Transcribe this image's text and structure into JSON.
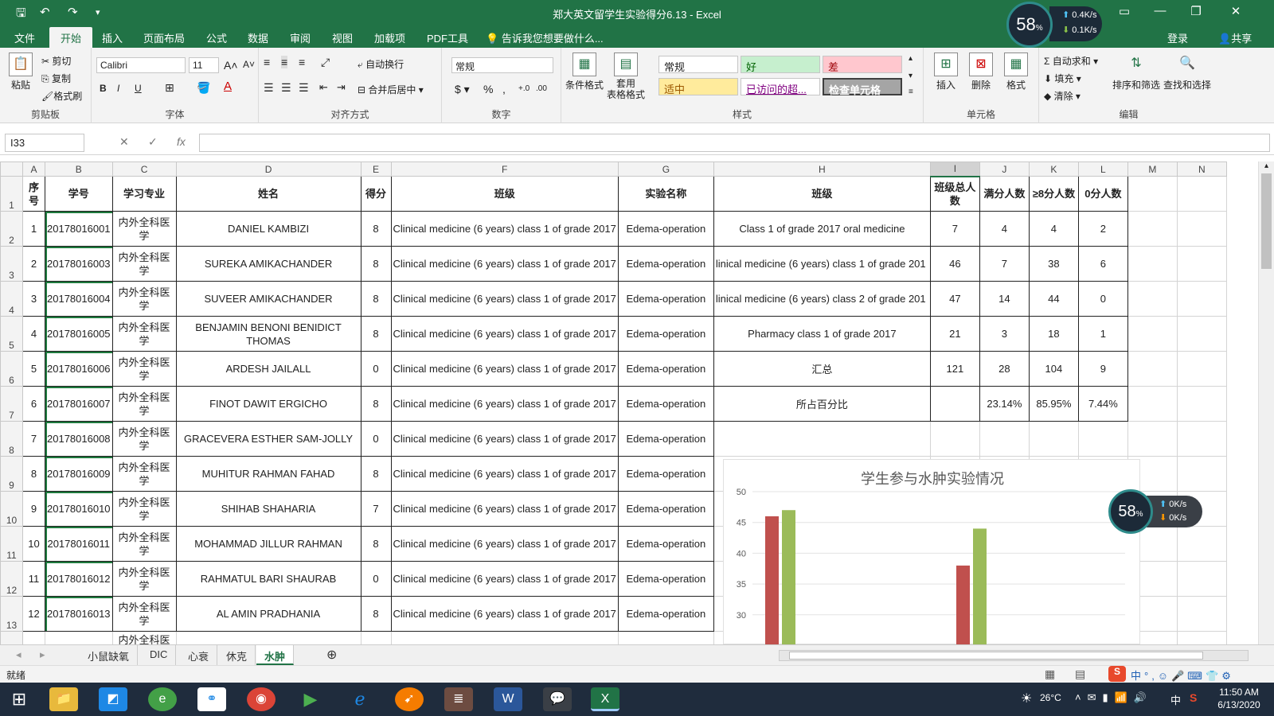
{
  "window": {
    "title": "郑大英文留学生实验得分6.13 - Excel"
  },
  "menus": [
    "文件",
    "开始",
    "插入",
    "页面布局",
    "公式",
    "数据",
    "审阅",
    "视图",
    "加载项",
    "PDF工具"
  ],
  "active_menu": "开始",
  "tell_me": "告诉我您想要做什么...",
  "account": {
    "login": "登录",
    "share": "共享"
  },
  "net_widget": {
    "percent": "58",
    "unit": "%",
    "up": "0.4K/s",
    "down": "0.1K/s"
  },
  "net_widget2": {
    "percent": "58",
    "unit": "%",
    "up": "0K/s",
    "down": "0K/s"
  },
  "ribbon": {
    "clipboard": {
      "paste": "粘贴",
      "cut": "剪切",
      "copy": "复制",
      "format_painter": "格式刷",
      "label": "剪贴板"
    },
    "font": {
      "name": "Calibri",
      "size": "11",
      "label": "字体",
      "bold": "B",
      "italic": "I",
      "underline": "U"
    },
    "align": {
      "wrap": "自动换行",
      "merge": "合并后居中",
      "label": "对齐方式"
    },
    "number": {
      "format": "常规",
      "label": "数字"
    },
    "styles": {
      "cond": "条件格式",
      "table": "套用\n表格格式",
      "normal": "常规",
      "good": "好",
      "bad": "差",
      "neutral": "适中",
      "visited": "已访问的超...",
      "check": "检查单元格",
      "label": "样式"
    },
    "cells": {
      "insert": "插入",
      "delete": "删除",
      "format": "格式",
      "label": "单元格"
    },
    "editing": {
      "autosum": "自动求和",
      "fill": "填充",
      "clear": "清除",
      "sort": "排序和筛选",
      "find": "查找和选择",
      "label": "编辑"
    }
  },
  "namebox": "I33",
  "columns": [
    "A",
    "B",
    "C",
    "D",
    "E",
    "F",
    "G",
    "H",
    "I",
    "J",
    "K",
    "L",
    "M",
    "N"
  ],
  "header_row": [
    "序号",
    "学号",
    "学习专业",
    "姓名",
    "得分",
    "班级",
    "实验名称",
    "班级",
    "班级总人数",
    "满分人数",
    "≥8分人数",
    "0分人数"
  ],
  "rows": [
    {
      "n": "1",
      "id": "20178016001",
      "major": "内外全科医学",
      "name": "DANIEL KAMBIZI",
      "score": "8",
      "class": "Clinical medicine (6 years) class 1 of grade 2017",
      "exp": "Edema-operation",
      "h": "Class 1 of grade 2017 oral medicine",
      "i": "7",
      "j": "4",
      "k": "4",
      "l": "2"
    },
    {
      "n": "2",
      "id": "20178016003",
      "major": "内外全科医学",
      "name": "SUREKA AMIKACHANDER",
      "score": "8",
      "class": "Clinical medicine (6 years) class 1 of grade 2017",
      "exp": "Edema-operation",
      "h": "linical medicine (6 years) class 1 of grade 201",
      "i": "46",
      "j": "7",
      "k": "38",
      "l": "6"
    },
    {
      "n": "3",
      "id": "20178016004",
      "major": "内外全科医学",
      "name": "SUVEER AMIKACHANDER",
      "score": "8",
      "class": "Clinical medicine (6 years) class 1 of grade 2017",
      "exp": "Edema-operation",
      "h": "linical medicine (6 years) class 2 of grade 201",
      "i": "47",
      "j": "14",
      "k": "44",
      "l": "0"
    },
    {
      "n": "4",
      "id": "20178016005",
      "major": "内外全科医学",
      "name": "BENJAMIN BENONI BENIDICT THOMAS",
      "score": "8",
      "class": "Clinical medicine (6 years) class 1 of grade 2017",
      "exp": "Edema-operation",
      "h": "Pharmacy class 1 of grade 2017",
      "i": "21",
      "j": "3",
      "k": "18",
      "l": "1"
    },
    {
      "n": "5",
      "id": "20178016006",
      "major": "内外全科医学",
      "name": "ARDESH JAILALL",
      "score": "0",
      "class": "Clinical medicine (6 years) class 1 of grade 2017",
      "exp": "Edema-operation",
      "h": "汇总",
      "i": "121",
      "j": "28",
      "k": "104",
      "l": "9"
    },
    {
      "n": "6",
      "id": "20178016007",
      "major": "内外全科医学",
      "name": "FINOT DAWIT ERGICHO",
      "score": "8",
      "class": "Clinical medicine (6 years) class 1 of grade 2017",
      "exp": "Edema-operation",
      "h": "所占百分比",
      "i": "",
      "j": "23.14%",
      "k": "85.95%",
      "l": "7.44%"
    },
    {
      "n": "7",
      "id": "20178016008",
      "major": "内外全科医学",
      "name": "GRACEVERA ESTHER SAM-JOLLY",
      "score": "0",
      "class": "Clinical medicine (6 years) class 1 of grade 2017",
      "exp": "Edema-operation"
    },
    {
      "n": "8",
      "id": "20178016009",
      "major": "内外全科医学",
      "name": "MUHITUR RAHMAN FAHAD",
      "score": "8",
      "class": "Clinical medicine (6 years) class 1 of grade 2017",
      "exp": "Edema-operation"
    },
    {
      "n": "9",
      "id": "20178016010",
      "major": "内外全科医学",
      "name": "SHIHAB SHAHARIA",
      "score": "7",
      "class": "Clinical medicine (6 years) class 1 of grade 2017",
      "exp": "Edema-operation"
    },
    {
      "n": "10",
      "id": "20178016011",
      "major": "内外全科医学",
      "name": "MOHAMMAD JILLUR RAHMAN",
      "score": "8",
      "class": "Clinical medicine (6 years) class 1 of grade 2017",
      "exp": "Edema-operation"
    },
    {
      "n": "11",
      "id": "20178016012",
      "major": "内外全科医学",
      "name": "RAHMATUL BARI SHAURAB",
      "score": "0",
      "class": "Clinical medicine (6 years) class 1 of grade 2017",
      "exp": "Edema-operation"
    },
    {
      "n": "12",
      "id": "20178016013",
      "major": "内外全科医学",
      "name": "AL AMIN PRADHANIA",
      "score": "8",
      "class": "Clinical medicine (6 years) class 1 of grade 2017",
      "exp": "Edema-operation"
    }
  ],
  "row14_major": "内外全科医",
  "chart_data": {
    "type": "bar",
    "title": "学生参与水肿实验情况",
    "y_ticks": [
      "50",
      "45",
      "40",
      "35",
      "30"
    ],
    "ylim": [
      30,
      50
    ],
    "groups": [
      {
        "values": [
          46,
          47
        ]
      },
      {
        "values": [
          38,
          44
        ]
      }
    ],
    "series_colors": [
      "#c0504d",
      "#9bbb59"
    ]
  },
  "sheets": [
    "小鼠缺氧",
    "DIC",
    "心衰",
    "休克",
    "水肿"
  ],
  "active_sheet": "水肿",
  "status": "就绪",
  "tray": {
    "temp": "26°C",
    "time": "11:50 AM",
    "date": "6/13/2020",
    "ime": "中"
  }
}
